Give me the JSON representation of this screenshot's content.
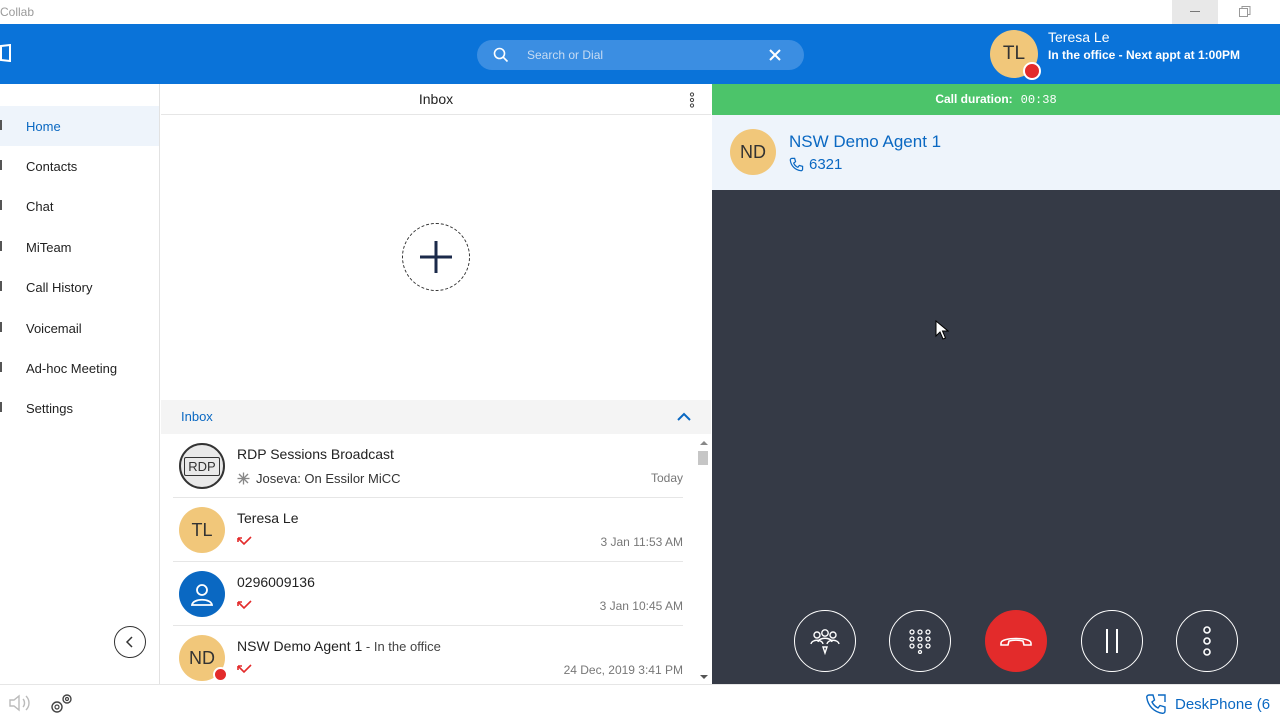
{
  "window": {
    "title": "Collab"
  },
  "search": {
    "placeholder": "Search or Dial"
  },
  "user": {
    "initials": "TL",
    "name": "Teresa Le",
    "status": "In the office - Next appt at 1:00PM"
  },
  "sidebar": {
    "items": [
      {
        "label": "Home",
        "active": true
      },
      {
        "label": "Contacts"
      },
      {
        "label": "Chat"
      },
      {
        "label": "MiTeam"
      },
      {
        "label": "Call History"
      },
      {
        "label": "Voicemail"
      },
      {
        "label": "Ad-hoc Meeting"
      },
      {
        "label": "Settings"
      }
    ]
  },
  "inbox": {
    "title": "Inbox",
    "section_label": "Inbox",
    "items": [
      {
        "avatar": "RDP",
        "name": "RDP Sessions Broadcast",
        "subtitle": "Joseva: On Essilor MiCC",
        "time": "Today"
      },
      {
        "avatar": "TL",
        "name": "Teresa Le",
        "subtitle": "",
        "time": "3 Jan 11:53 AM"
      },
      {
        "avatar": "",
        "name": "0296009136",
        "subtitle": "",
        "time": "3 Jan 10:45 AM"
      },
      {
        "avatar": "ND",
        "name": "NSW Demo Agent 1",
        "name_suffix": " - In the office",
        "subtitle": "",
        "time": "24 Dec, 2019 3:41 PM"
      }
    ]
  },
  "call": {
    "duration_label": "Call duration:",
    "duration_value": "00:38",
    "caller_initials": "ND",
    "caller_name": "NSW Demo Agent 1",
    "caller_ext": "6321"
  },
  "statusbar": {
    "device_label": "DeskPhone (6"
  },
  "colors": {
    "brand": "#0a73d9",
    "call_active": "#4cc46a",
    "end_call": "#e32b2b",
    "call_bg": "#353a46",
    "avatar": "#f1c77a"
  }
}
